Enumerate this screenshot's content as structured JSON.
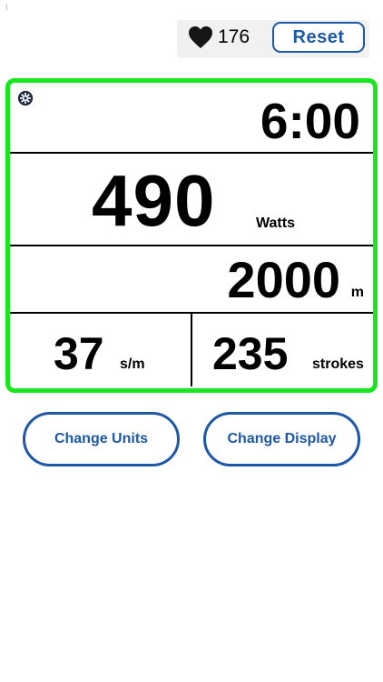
{
  "header": {
    "heart_rate": "176",
    "reset_label": "Reset"
  },
  "monitor": {
    "time": "6:00",
    "power": {
      "value": "490",
      "unit": "Watts"
    },
    "distance": {
      "value": "2000",
      "unit": "m"
    },
    "stroke_rate": {
      "value": "37",
      "unit": "s/m"
    },
    "strokes": {
      "value": "235",
      "unit": "strokes"
    }
  },
  "actions": {
    "change_units_label": "Change Units",
    "change_display_label": "Change Display"
  },
  "colors": {
    "panel_border": "#18e61e",
    "accent": "#1d57a6"
  },
  "icons": [
    "heart-icon",
    "gear-icon"
  ]
}
